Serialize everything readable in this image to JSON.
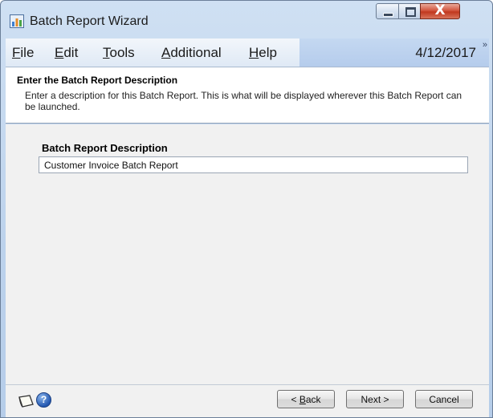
{
  "window": {
    "title": "Batch Report Wizard",
    "icons": {
      "app": "report-icon",
      "minimize": "minimize-icon",
      "maximize": "maximize-icon",
      "close": "close-icon"
    },
    "close_glyph": "X"
  },
  "menu": {
    "items": [
      {
        "pre": "",
        "key": "F",
        "post": "ile"
      },
      {
        "pre": "",
        "key": "E",
        "post": "dit"
      },
      {
        "pre": "",
        "key": "T",
        "post": "ools"
      },
      {
        "pre": "",
        "key": "A",
        "post": "dditional"
      },
      {
        "pre": "",
        "key": "H",
        "post": "elp"
      }
    ],
    "date": "4/12/2017",
    "overflow_glyph": "»"
  },
  "banner": {
    "title": "Enter the Batch Report Description",
    "description": "Enter a description for this Batch Report.  This is what will be displayed wherever this Batch Report can be launched."
  },
  "form": {
    "label": "Batch Report Description",
    "value": "Customer Invoice Batch Report"
  },
  "footer": {
    "icons": {
      "note": "note-icon",
      "help": "help-icon"
    },
    "help_glyph": "?",
    "back": {
      "pre": "< ",
      "key": "B",
      "post": "ack"
    },
    "next_label": "Next >",
    "cancel_label": "Cancel"
  },
  "colors": {
    "frame": "#bcd2ec",
    "menu_highlight": "#b5ccec",
    "close_button": "#c0381f",
    "content_bg": "#f1f1f1"
  }
}
